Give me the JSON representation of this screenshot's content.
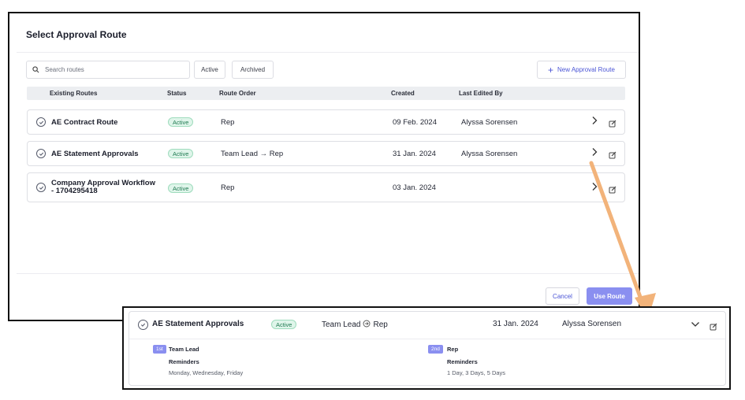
{
  "dialog": {
    "title": "Select Approval Route",
    "search_placeholder": "Search routes",
    "filters": [
      "Active",
      "Archived"
    ],
    "new_route_label": "New Approval Route",
    "columns": [
      "Existing Routes",
      "Status",
      "Route Order",
      "Created",
      "Last Edited By"
    ],
    "routes": [
      {
        "name": "AE Contract Route",
        "status": "Active",
        "route_order": "Rep",
        "created": "09 Feb. 2024",
        "last_edited_by": "Alyssa Sorensen"
      },
      {
        "name": "AE Statement Approvals",
        "status": "Active",
        "route_order": "Team Lead → Rep",
        "created": "31 Jan. 2024",
        "last_edited_by": "Alyssa Sorensen"
      },
      {
        "name_line1": "Company Approval Workflow",
        "name_line2": "- 1704295418",
        "status": "Active",
        "route_order": "Rep",
        "created": "03 Jan. 2024",
        "last_edited_by": ""
      }
    ],
    "cancel_label": "Cancel",
    "use_label": "Use Route"
  },
  "zoom": {
    "name": "AE Statement Approvals",
    "status": "Active",
    "route_order_from": "Team Lead",
    "route_order_to": "Rep",
    "created": "31 Jan. 2024",
    "last_edited_by": "Alyssa Sorensen",
    "steps": [
      {
        "tag": "1st",
        "title": "Team Lead",
        "reminders_label": "Reminders",
        "reminders": "Monday, Wednesday, Friday"
      },
      {
        "tag": "2nd",
        "title": "Rep",
        "reminders_label": "Reminders",
        "reminders": "1 Day, 3 Days, 5 Days"
      }
    ]
  },
  "colors": {
    "accent": "#4b55d6",
    "primary_button": "#8a8ff0",
    "badge_bg": "#dff5ea",
    "badge_text": "#207a52",
    "annotation_arrow": "#f2b37a"
  }
}
